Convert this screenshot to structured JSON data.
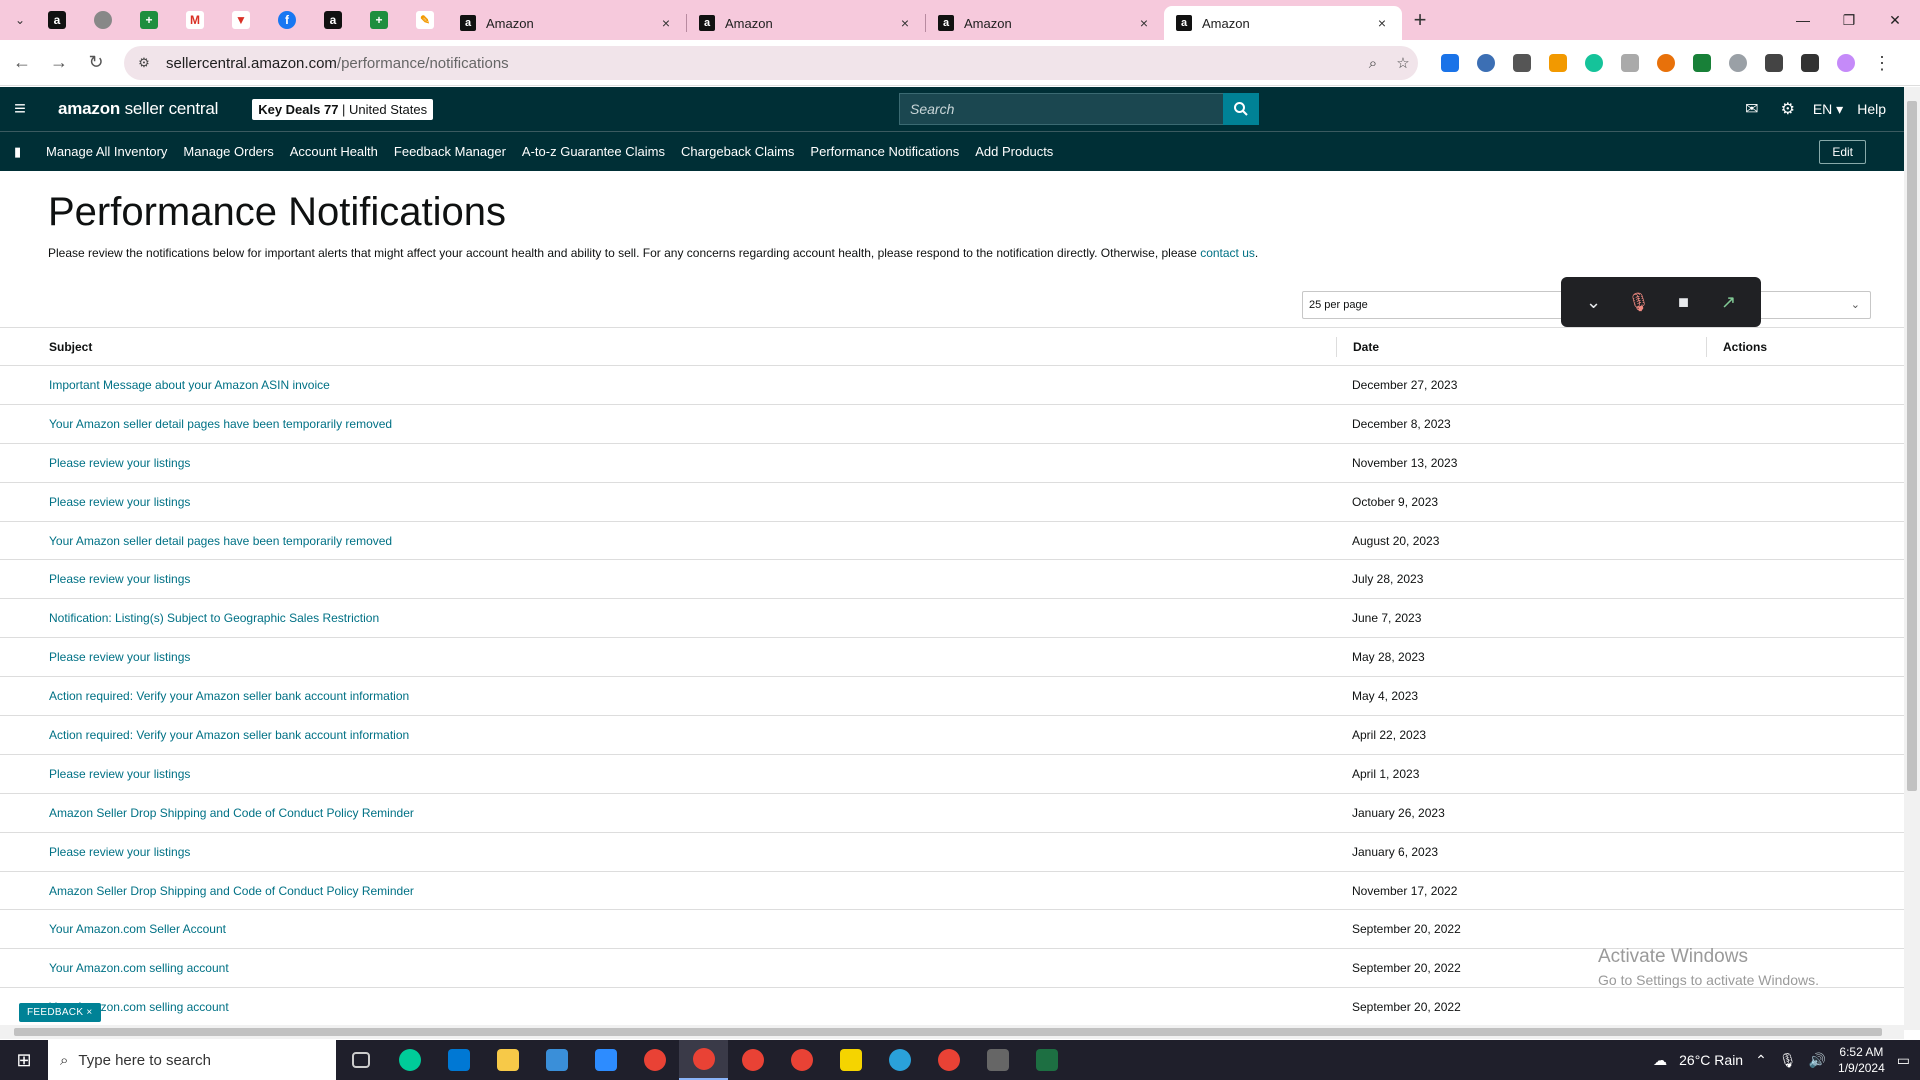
{
  "browser": {
    "tabs": [
      {
        "title": "Amazon"
      },
      {
        "title": "Amazon"
      },
      {
        "title": "Amazon"
      },
      {
        "title": "Amazon"
      }
    ],
    "url_host": "sellercentral.amazon.com",
    "url_path": "/performance/notifications"
  },
  "header": {
    "logo_main": "amazon",
    "logo_sub": " seller central",
    "store_name": "Key Deals 77",
    "store_sep": " | ",
    "store_region": "United States",
    "search_placeholder": "Search",
    "language": "EN",
    "help": "Help"
  },
  "nav": {
    "items": [
      "Manage All Inventory",
      "Manage Orders",
      "Account Health",
      "Feedback Manager",
      "A-to-z Guarantee Claims",
      "Chargeback Claims",
      "Performance Notifications",
      "Add Products"
    ],
    "edit": "Edit"
  },
  "page": {
    "title": "Performance Notifications",
    "description": "Please review the notifications below for important alerts that might affect your account health and ability to sell. For any concerns regarding account health, please respond to the notification directly. Otherwise, please ",
    "contact_link": "contact us",
    "description_end": ".",
    "per_page": "25 per page"
  },
  "table": {
    "headers": {
      "subject": "Subject",
      "date": "Date",
      "actions": "Actions"
    },
    "rows": [
      {
        "subject": "Important Message about your Amazon ASIN invoice",
        "date": "December 27, 2023"
      },
      {
        "subject": "Your Amazon seller detail pages have been temporarily removed",
        "date": "December 8, 2023"
      },
      {
        "subject": "Please review your listings",
        "date": "November 13, 2023"
      },
      {
        "subject": "Please review your listings",
        "date": "October 9, 2023"
      },
      {
        "subject": "Your Amazon seller detail pages have been temporarily removed",
        "date": "August 20, 2023"
      },
      {
        "subject": "Please review your listings",
        "date": "July 28, 2023"
      },
      {
        "subject": "Notification: Listing(s) Subject to Geographic Sales Restriction",
        "date": "June 7, 2023"
      },
      {
        "subject": "Please review your listings",
        "date": "May 28, 2023"
      },
      {
        "subject": "Action required: Verify your Amazon seller bank account information",
        "date": "May 4, 2023"
      },
      {
        "subject": "Action required: Verify your Amazon seller bank account information",
        "date": "April 22, 2023"
      },
      {
        "subject": "Please review your listings",
        "date": "April 1, 2023"
      },
      {
        "subject": "Amazon Seller Drop Shipping and Code of Conduct Policy Reminder",
        "date": "January 26, 2023"
      },
      {
        "subject": "Please review your listings",
        "date": "January 6, 2023"
      },
      {
        "subject": "Amazon Seller Drop Shipping and Code of Conduct Policy Reminder",
        "date": "November 17, 2022"
      },
      {
        "subject": "Your Amazon.com Seller Account",
        "date": "September 20, 2022"
      },
      {
        "subject": "Your Amazon.com selling account",
        "date": "September 20, 2022"
      },
      {
        "subject": "Your Amazon.com selling account",
        "date": "September 20, 2022"
      }
    ]
  },
  "overlay": {
    "feedback": "FEEDBACK ×",
    "activate_title": "Activate Windows",
    "activate_sub": "Go to Settings to activate Windows."
  },
  "taskbar": {
    "search_placeholder": "Type here to search",
    "weather": "26°C  Rain",
    "time": "6:52 AM",
    "date": "1/9/2024"
  },
  "colors": {
    "header_bg": "#002f36",
    "link": "#007185",
    "accent": "#008296",
    "tab_strip": "#f6c9dc"
  }
}
